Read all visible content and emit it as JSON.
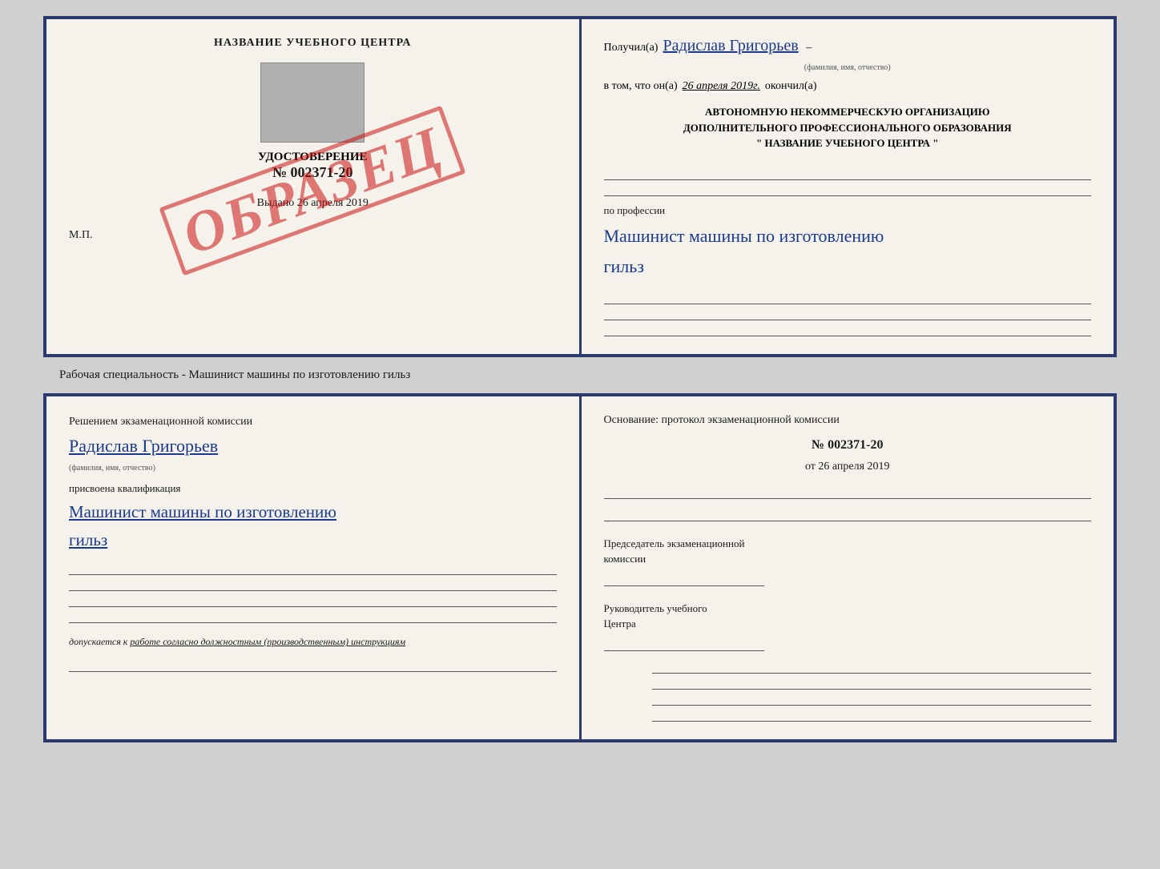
{
  "top_cert": {
    "left": {
      "title": "НАЗВАНИЕ УЧЕБНОГО ЦЕНТРА",
      "stamp": "ОБРАЗЕЦ",
      "udostoverenie_label": "УДОСТОВЕРЕНИЕ",
      "number": "№ 002371-20",
      "vydano_label": "Выдано",
      "vydano_date": "26 апреля 2019",
      "mp": "М.П."
    },
    "right": {
      "poluchil_label": "Получил(а)",
      "poluchil_name": "Радислав Григорьев",
      "fio_label": "(фамилия, имя, отчество)",
      "v_tom_label": "в том, что он(а)",
      "date_value": "26 апреля 2019г.",
      "okonchil_label": "окончил(а)",
      "org_line1": "АВТОНОМНУЮ НЕКОММЕРЧЕСКУЮ ОРГАНИЗАЦИЮ",
      "org_line2": "ДОПОЛНИТЕЛЬНОГО ПРОФЕССИОНАЛЬНОГО ОБРАЗОВАНИЯ",
      "org_name": "\"   НАЗВАНИЕ УЧЕБНОГО ЦЕНТРА   \"",
      "po_professii_label": "по профессии",
      "profession_handwritten": "Машинист машины по изготовлению",
      "profession_line2": "гильз"
    }
  },
  "caption": "Рабочая специальность - Машинист машины по изготовлению гильз",
  "bottom_cert": {
    "left": {
      "resheniem_label": "Решением  экзаменационной  комиссии",
      "name_handwritten": "Радислав Григорьев",
      "fio_label": "(фамилия, имя, отчество)",
      "prisvoena_label": "присвоена квалификация",
      "qualification_handwritten": "Машинист  машины  по  изготовлению",
      "qualification_line2": "гильз",
      "dopuskaetsya_label": "допускается к",
      "dopuskaetsya_value": "работе согласно должностным (производственным) инструкциям"
    },
    "right": {
      "osnovaniye_label": "Основание:  протокол  экзаменационной  комиссии",
      "protocol_num": "№  002371-20",
      "ot_label": "от",
      "ot_date": "26 апреля 2019",
      "predsedatel_line1": "Председатель экзаменационной",
      "predsedatel_line2": "комиссии",
      "rukovoditel_line1": "Руководитель учебного",
      "rukovoditel_line2": "Центра"
    }
  }
}
